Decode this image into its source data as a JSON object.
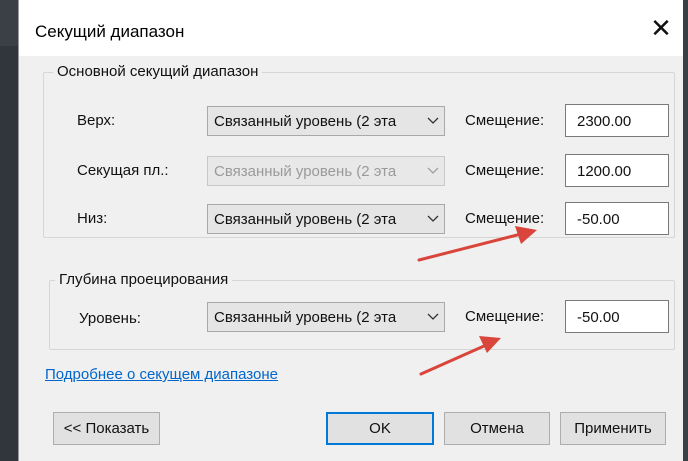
{
  "dialog": {
    "title": "Секущий диапазон",
    "close_glyph": "✕"
  },
  "primary_range": {
    "group_label": "Основной секущий диапазон",
    "rows": [
      {
        "label": "Верх:",
        "combo_value": "Связанный уровень (2 эта",
        "combo_enabled": true,
        "offset_label": "Смещение:",
        "offset_value": "2300.00"
      },
      {
        "label": "Секущая пл.:",
        "combo_value": "Связанный уровень (2 эта",
        "combo_enabled": false,
        "offset_label": "Смещение:",
        "offset_value": "1200.00"
      },
      {
        "label": "Низ:",
        "combo_value": "Связанный уровень (2 эта",
        "combo_enabled": true,
        "offset_label": "Смещение:",
        "offset_value": "-50.00"
      }
    ]
  },
  "view_depth": {
    "group_label": "Глубина проецирования",
    "row": {
      "label": "Уровень:",
      "combo_value": "Связанный уровень (2 эта",
      "offset_label": "Смещение:",
      "offset_value": "-50.00"
    }
  },
  "link_text": "Подробнее о секущем диапазоне",
  "buttons": {
    "show": "<< Показать",
    "ok": "OK",
    "cancel": "Отмена",
    "apply": "Применить"
  },
  "annotation_color": "#d9453a"
}
